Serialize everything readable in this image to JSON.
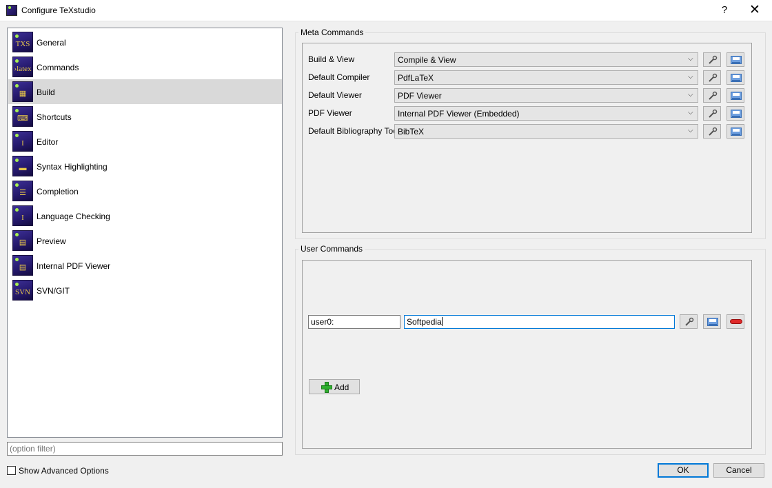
{
  "window": {
    "title": "Configure TeXstudio",
    "help": "?",
    "close": "✕"
  },
  "nav": {
    "items": [
      {
        "label": "General",
        "glyph": "TXS",
        "selected": false
      },
      {
        "label": "Commands",
        "glyph": "›latex",
        "selected": false
      },
      {
        "label": "Build",
        "glyph": "▦",
        "selected": true
      },
      {
        "label": "Shortcuts",
        "glyph": "⌨",
        "selected": false
      },
      {
        "label": "Editor",
        "glyph": "I",
        "selected": false
      },
      {
        "label": "Syntax Highlighting",
        "glyph": "▬",
        "selected": false
      },
      {
        "label": "Completion",
        "glyph": "☰",
        "selected": false
      },
      {
        "label": "Language Checking",
        "glyph": "I",
        "selected": false
      },
      {
        "label": "Preview",
        "glyph": "▤",
        "selected": false
      },
      {
        "label": "Internal PDF Viewer",
        "glyph": "▤",
        "selected": false
      },
      {
        "label": "SVN/GIT",
        "glyph": "SVN",
        "selected": false
      }
    ],
    "filter_placeholder": "(option filter)",
    "advanced_label": "Show Advanced Options"
  },
  "meta": {
    "title": "Meta Commands",
    "rows": [
      {
        "label": "Build & View",
        "value": "Compile & View"
      },
      {
        "label": "Default Compiler",
        "value": "PdfLaTeX"
      },
      {
        "label": "Default Viewer",
        "value": "PDF Viewer"
      },
      {
        "label": "PDF Viewer",
        "value": "Internal PDF Viewer (Embedded)"
      },
      {
        "label": "Default Bibliography Tool",
        "value": "BibTeX"
      }
    ]
  },
  "user": {
    "title": "User Commands",
    "command_name": "user0:",
    "command_value": "Softpedia",
    "add_label": "Add"
  },
  "buttons": {
    "ok": "OK",
    "cancel": "Cancel"
  },
  "colors": {
    "accent": "#0078d7",
    "selection": "#d9d9d9",
    "icon_bg": "#2a1e78"
  }
}
